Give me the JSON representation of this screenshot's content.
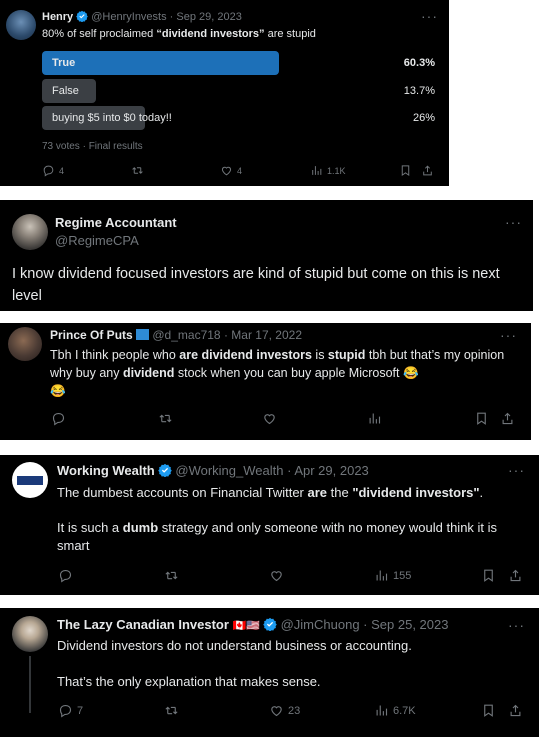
{
  "tweets": [
    {
      "name": "Henry",
      "handle": "@HenryInvests",
      "date": "· Sep 29, 2023",
      "text_plain": "80% of self proclaimed ",
      "text_bold": "“dividend investors”",
      "text_end": " are stupid",
      "poll": {
        "options": [
          {
            "label": "True",
            "percent_text": "60.3%",
            "percent": 60.3,
            "winner": true
          },
          {
            "label": "False",
            "percent_text": "13.7%",
            "percent": 13.7,
            "winner": false
          },
          {
            "label": "buying $5 into $0 today!!",
            "percent_text": "26%",
            "percent": 26,
            "winner": false
          }
        ],
        "footer": "73 votes · Final results"
      },
      "replies": "4",
      "likes": "4",
      "views": "1.1K",
      "colors": {
        "winner": "#1d70b8",
        "other": "#3b3f44"
      }
    },
    {
      "name": "Regime Accountant",
      "handle": "@RegimeCPA",
      "text": "I know dividend focused investors are kind of stupid but come on this is next level"
    },
    {
      "name": "Prince Of Puts",
      "handle": "@d_mac718",
      "date": "· Mar 17, 2022",
      "t1": "Tbh I think people who ",
      "t2": "are dividend investors",
      "t3": " is ",
      "t4": "stupid",
      "t5": " tbh but that’s my opinion why buy any ",
      "t6": "dividend",
      "t7": " stock when you can buy apple Microsoft 😂",
      "t8": "😂"
    },
    {
      "name": "Working Wealth",
      "handle": "@Working_Wealth",
      "date": "· Apr 29, 2023",
      "p1a": "The dumbest accounts on Financial Twitter ",
      "p1b": "are",
      "p1c": " the ",
      "p1d": "\"dividend investors\"",
      "p1e": ".",
      "p2a": "It is such a ",
      "p2b": "dumb",
      "p2c": " strategy and only someone with no money would think it is smart",
      "views": "155"
    },
    {
      "name": "The Lazy Canadian Investor",
      "flags": "🇨🇦🇺🇸",
      "handle": "@JimChuong",
      "date": "· Sep 25, 2023",
      "p1": "Dividend investors do not understand business or accounting.",
      "p2": "That’s the only explanation that makes sense.",
      "replies": "7",
      "likes": "23",
      "views": "6.7K"
    }
  ],
  "more_icon": "···"
}
